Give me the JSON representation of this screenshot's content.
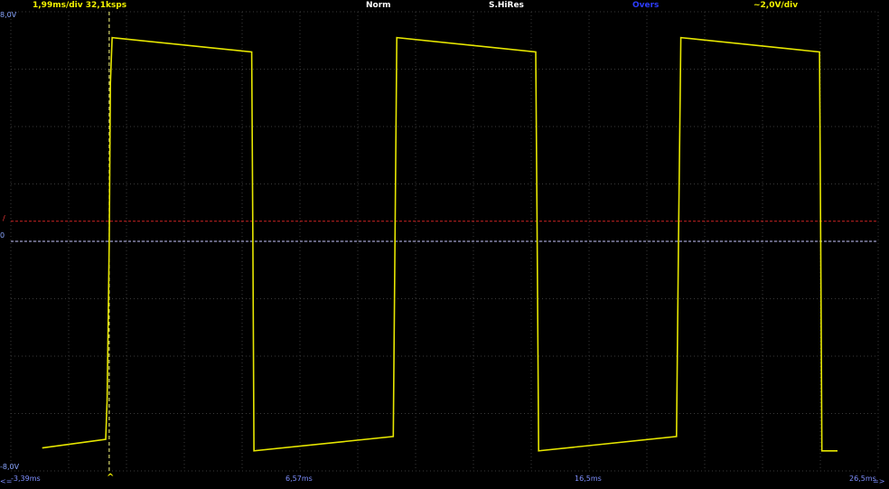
{
  "header": {
    "timebase": "1,99ms/div  32,1ksps",
    "trigger_mode": "Norm",
    "acquisition": "S.HiRes",
    "oversampling": "Overs",
    "volts_per_div": "~2,0V/div"
  },
  "vertical": {
    "top_label": "8,0V",
    "bottom_label": "-8,0V",
    "zero_label": "0",
    "trigger_label": "/"
  },
  "horizontal": {
    "left_arrow": "<=",
    "right_arrow": "=>",
    "trigger_caret": "^",
    "time_labels": [
      "-3,39ms",
      "6,57ms",
      "16,5ms",
      "26,5ms"
    ]
  },
  "colors": {
    "trace": "#e6e600",
    "grid": "#3a3a3a",
    "trigger_level": "#cc2222",
    "zero_level": "#c8c8ff",
    "trigger_time": "#ffff80"
  },
  "chart_data": {
    "type": "line",
    "xlabel": "",
    "ylabel": "",
    "xlim": [
      -3.39,
      26.5
    ],
    "ylim": [
      -8.0,
      8.0
    ],
    "grid": true,
    "trigger_level_v": 0.7,
    "trigger_time_ms": 0.0,
    "series": [
      {
        "x": [
          -2.31,
          -0.12,
          -0.07,
          0.0,
          0.04,
          0.1,
          4.91,
          4.95,
          4.99,
          9.79,
          9.85,
          9.91,
          14.7,
          14.75,
          14.8,
          19.55,
          19.62,
          19.7,
          24.48,
          24.52,
          24.56,
          25.1
        ],
        "y": [
          -7.2,
          -6.9,
          -5.5,
          0.0,
          5.5,
          7.1,
          6.6,
          0.0,
          -7.3,
          -6.8,
          0.0,
          7.1,
          6.6,
          0.0,
          -7.3,
          -6.8,
          0.0,
          7.1,
          6.6,
          0.0,
          -7.3,
          -7.3
        ]
      }
    ]
  }
}
